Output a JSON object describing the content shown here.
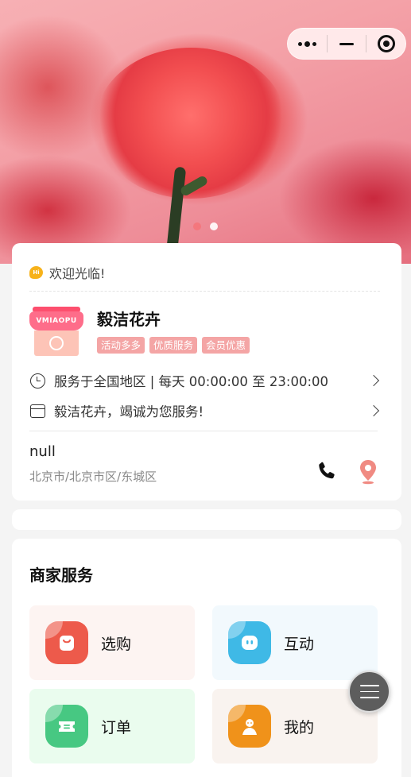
{
  "banner": {
    "alt": "carnation banner",
    "slides": 2,
    "active_slide": 0
  },
  "capsule": {
    "menu_icon": "more-dots-icon",
    "minimize_icon": "minus-icon",
    "close_icon": "target-icon"
  },
  "store": {
    "welcome": "欢迎光临!",
    "name": "毅洁花卉",
    "logo_text": "VMIAOPU",
    "tags": [
      "活动多多",
      "优质服务",
      "会员优惠"
    ],
    "service_hours": "服务于全国地区 | 每天 00:00:00 至 23:00:00",
    "slogan": "毅洁花卉，竭诚为您服务!",
    "address_name": "null",
    "address": "北京市/北京市区/东城区"
  },
  "services": {
    "title": "商家服务",
    "items": [
      {
        "label": "选购",
        "icon": "shopping-bag-icon",
        "bg": "#fdf4f2",
        "color": "#ed5a4b"
      },
      {
        "label": "互动",
        "icon": "chat-face-icon",
        "bg": "#f2f9fd",
        "color": "#3fb9e6"
      },
      {
        "label": "订单",
        "icon": "ticket-icon",
        "bg": "#eafcee",
        "color": "#47c882"
      },
      {
        "label": "我的",
        "icon": "user-icon",
        "bg": "#f9f3ef",
        "color": "#f0921a"
      }
    ]
  },
  "colors": {
    "tag_bg": "#f4a5a5",
    "accent_pink": "#f4747a"
  }
}
